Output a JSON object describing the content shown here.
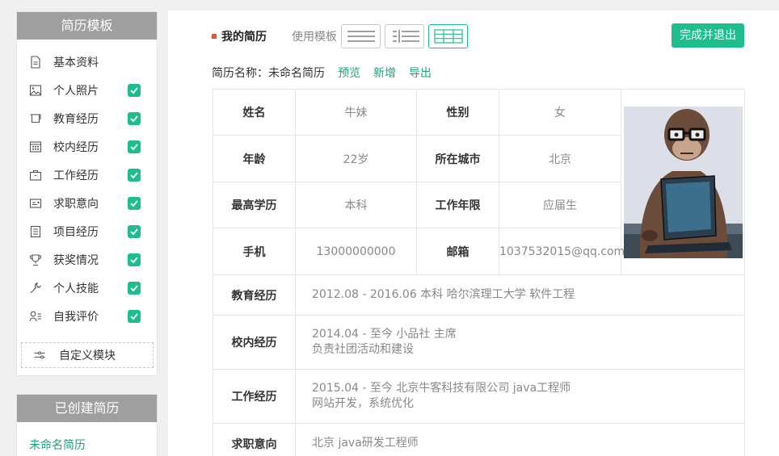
{
  "sidebar": {
    "template_title": "简历模板",
    "modules": [
      {
        "label": "基本资料",
        "icon": "doc-icon",
        "checked": false
      },
      {
        "label": "个人照片",
        "icon": "image-icon",
        "checked": true
      },
      {
        "label": "教育经历",
        "icon": "graduation-icon",
        "checked": true
      },
      {
        "label": "校内经历",
        "icon": "calendar-icon",
        "checked": true
      },
      {
        "label": "工作经历",
        "icon": "briefcase-icon",
        "checked": true
      },
      {
        "label": "求职意向",
        "icon": "id-card-icon",
        "checked": true
      },
      {
        "label": "项目经历",
        "icon": "list-doc-icon",
        "checked": true
      },
      {
        "label": "获奖情况",
        "icon": "trophy-icon",
        "checked": true
      },
      {
        "label": "个人技能",
        "icon": "wrench-icon",
        "checked": true
      },
      {
        "label": "自我评价",
        "icon": "user-list-icon",
        "checked": true
      }
    ],
    "custom_module": "自定义模块",
    "created_title": "已创建简历",
    "created_items": [
      "未命名简历"
    ]
  },
  "toolbar": {
    "my_resume": "我的简历",
    "use_template": "使用模板",
    "finish_label": "完成并退出",
    "active_layout": 3
  },
  "resume_meta": {
    "name_label": "简历名称：",
    "name_value": "未命名简历",
    "preview": "预览",
    "add": "新增",
    "export": "导出"
  },
  "basic": {
    "name_label": "姓名",
    "name": "牛妹",
    "gender_label": "性别",
    "gender": "女",
    "age_label": "年龄",
    "age": "22岁",
    "city_label": "所在城市",
    "city": "北京",
    "edu_label": "最高学历",
    "edu": "本科",
    "years_label": "工作年限",
    "years": "应届生",
    "phone_label": "手机",
    "phone": "13000000000",
    "email_label": "邮箱",
    "email": "1037532015@qq.com"
  },
  "sections": {
    "education": {
      "label": "教育经历",
      "line1": "2012.08 - 2016.06  本科  哈尔滨理工大学  软件工程"
    },
    "campus": {
      "label": "校内经历",
      "line1": "2014.04 - 至今  小品社  主席",
      "line2": "负责社团活动和建设"
    },
    "work": {
      "label": "工作经历",
      "line1": "2015.04 - 至今  北京牛客科技有限公司  java工程师",
      "line2": "网站开发，系统优化"
    },
    "intent": {
      "label": "求职意向",
      "line1": "北京  java研发工程师"
    }
  },
  "colors": {
    "accent": "#1ebd8e",
    "link": "#1ea27c",
    "header": "#9f9f9f",
    "dot": "#e0533a"
  }
}
